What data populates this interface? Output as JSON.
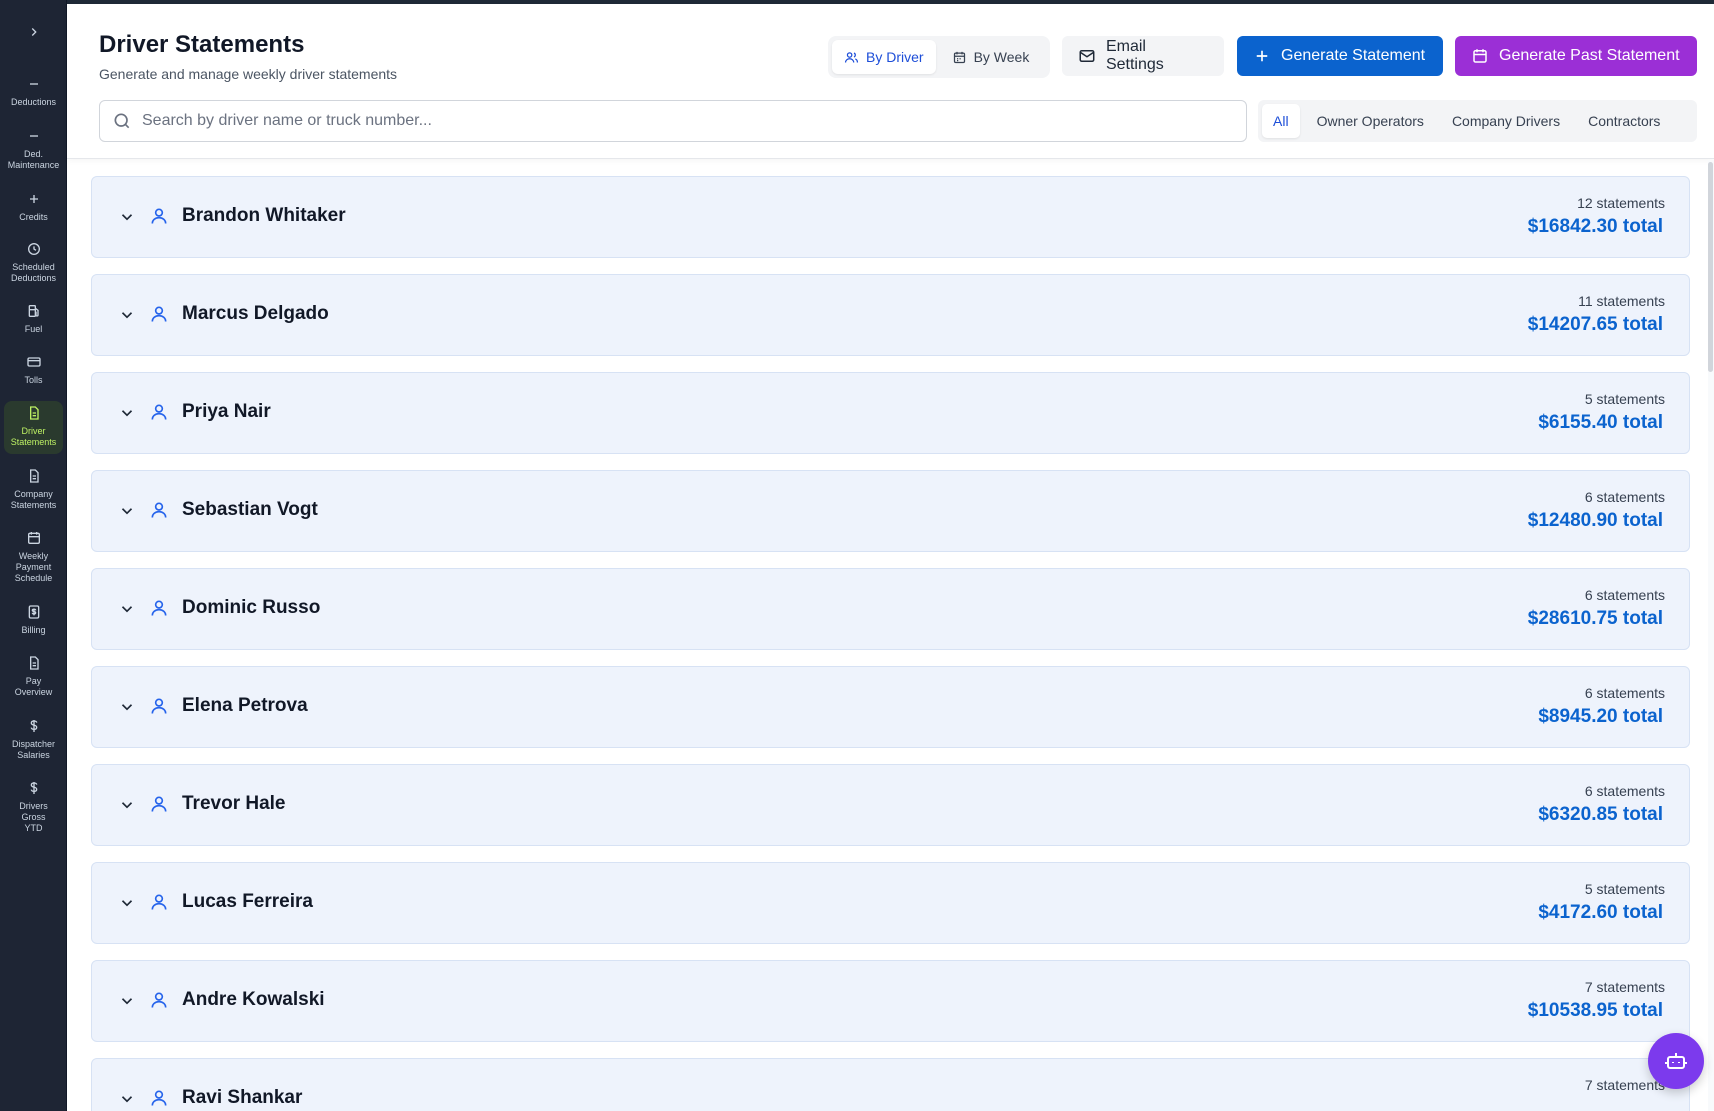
{
  "sidebar": {
    "toggle_icon": "chevron-right-icon",
    "items": [
      {
        "label": "Deductions",
        "icon": "minus-icon"
      },
      {
        "label": "Ded.\nMaintenance",
        "icon": "minus-icon"
      },
      {
        "label": "Credits",
        "icon": "plus-icon"
      },
      {
        "label": "Scheduled\nDeductions",
        "icon": "clock-icon"
      },
      {
        "label": "Fuel",
        "icon": "fuel-icon"
      },
      {
        "label": "Tolls",
        "icon": "credit-card-icon"
      },
      {
        "label": "Driver\nStatements",
        "icon": "document-icon",
        "active": true
      },
      {
        "label": "Company\nStatements",
        "icon": "document-icon"
      },
      {
        "label": "Weekly\nPayment\nSchedule",
        "icon": "calendar-icon"
      },
      {
        "label": "Billing",
        "icon": "receipt-icon"
      },
      {
        "label": "Pay\nOverview",
        "icon": "document-icon"
      },
      {
        "label": "Dispatcher\nSalaries",
        "icon": "dollar-icon"
      },
      {
        "label": "Drivers\nGross\nYTD",
        "icon": "dollar-icon"
      }
    ]
  },
  "header": {
    "title": "Driver Statements",
    "subtitle": "Generate and manage weekly driver statements",
    "view_toggle": {
      "by_driver": "By Driver",
      "by_week": "By Week"
    },
    "email_settings": "Email Settings",
    "generate_statement": "Generate Statement",
    "generate_past_statement": "Generate Past Statement"
  },
  "search": {
    "placeholder": "Search by driver name or truck number...",
    "value": ""
  },
  "filters": {
    "all": "All",
    "owner_operators": "Owner Operators",
    "company_drivers": "Company Drivers",
    "contractors": "Contractors",
    "active": "all"
  },
  "drivers": [
    {
      "name": "Brandon Whitaker",
      "count": "12 statements",
      "total": "$16842.30 total"
    },
    {
      "name": "Marcus Delgado",
      "count": "11 statements",
      "total": "$14207.65 total"
    },
    {
      "name": "Priya Nair",
      "count": "5 statements",
      "total": "$6155.40 total"
    },
    {
      "name": "Sebastian Vogt",
      "count": "6 statements",
      "total": "$12480.90 total"
    },
    {
      "name": "Dominic Russo",
      "count": "6 statements",
      "total": "$28610.75 total"
    },
    {
      "name": "Elena Petrova",
      "count": "6 statements",
      "total": "$8945.20 total"
    },
    {
      "name": "Trevor Hale",
      "count": "6 statements",
      "total": "$6320.85 total"
    },
    {
      "name": "Lucas Ferreira",
      "count": "5 statements",
      "total": "$4172.60 total"
    },
    {
      "name": "Andre Kowalski",
      "count": "7 statements",
      "total": "$10538.95 total"
    },
    {
      "name": "Ravi Shankar",
      "count": "7 statements",
      "total": ""
    }
  ],
  "colors": {
    "sidebar_bg": "#1e2534",
    "active_nav": "#bef264",
    "primary_blue": "#0b63ce",
    "purple": "#9b2fd6",
    "card_bg": "#eef3fc"
  }
}
